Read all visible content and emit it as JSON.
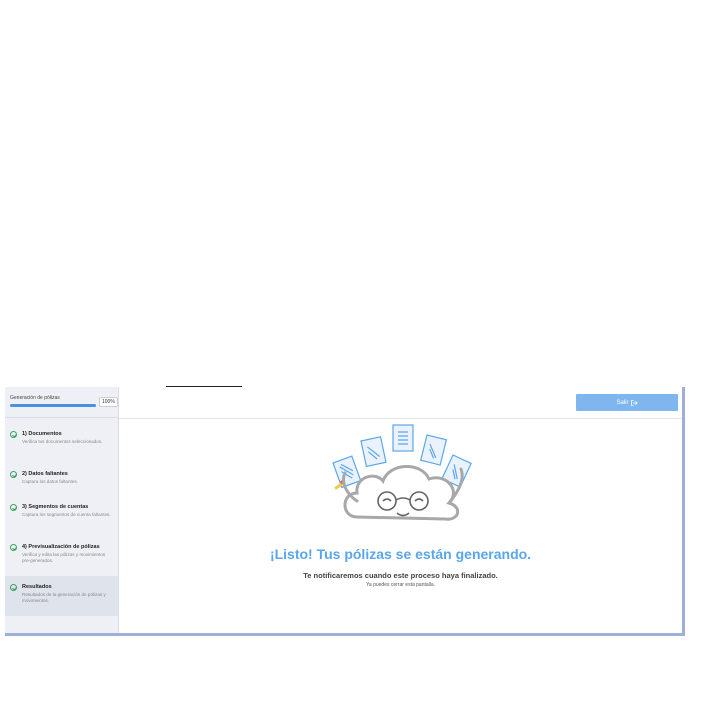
{
  "sidebar": {
    "progress": {
      "label": "Generación de pólizas",
      "percent_text": "100%",
      "value": 100
    },
    "steps": [
      {
        "title": "1) Documentos",
        "desc": "Verifica tus documentos seleccionados."
      },
      {
        "title": "2) Datos faltantes",
        "desc": "Captura los datos faltantes."
      },
      {
        "title": "3) Segmentos de cuentas",
        "desc": "Captura los segmentos de cuenta faltantes."
      },
      {
        "title": "4) Previsualización de pólizas",
        "desc": "Verifica y edita las pólizas y movimientos pre-generados."
      },
      {
        "title": "Resultados",
        "desc": "Resultados de la generación de pólizas y movimientos."
      }
    ]
  },
  "header": {
    "exit_label": "Salir",
    "exit_icon": "sign-out-icon"
  },
  "main": {
    "headline": "¡Listo! Tus pólizas se están generando.",
    "notify": "Te notificaremos cuando este proceso haya finalizado.",
    "close_hint": "Ya puedes cerrar esta pantalla."
  },
  "colors": {
    "accent": "#5aa6ec",
    "button": "#7fb6ef",
    "success": "#3aa35a",
    "sidebar_bg": "#eef0f5"
  }
}
